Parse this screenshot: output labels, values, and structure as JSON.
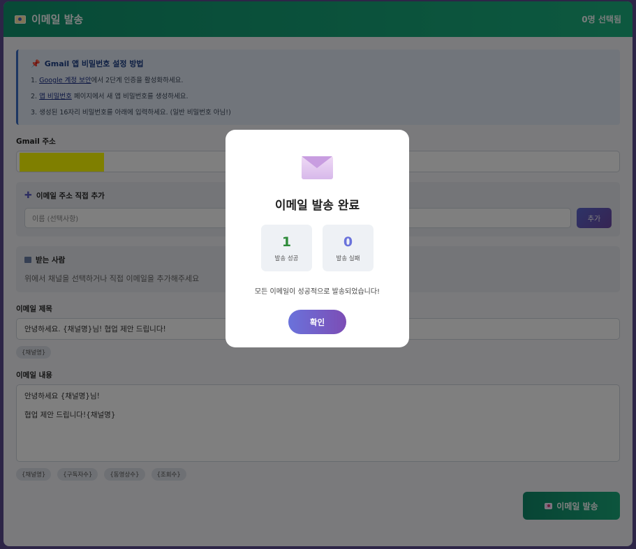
{
  "header": {
    "title": "이메일 발송",
    "selected_count": "0명 선택됨",
    "icon": "envelope-icon"
  },
  "guide": {
    "title": "Gmail 앱 비밀번호 설정 방법",
    "step1_prefix": "1. ",
    "step1_link": "Google 계정 보안",
    "step1_suffix": "에서 2단계 인증을 활성화하세요.",
    "step2_prefix": "2. ",
    "step2_link": "앱 비밀번호",
    "step2_suffix": " 페이지에서 새 앱 비밀번호를 생성하세요.",
    "step3": "3. 생성된 16자리 비밀번호를 아래에 입력하세요. (일반 비밀번호 아님!)"
  },
  "gmail": {
    "label": "Gmail 주소",
    "value": "te"
  },
  "add_email": {
    "title": "이메일 주소 직접 추가",
    "name_placeholder": "이름 (선택사항)",
    "add_label": "추가"
  },
  "recipients": {
    "title": "받는 사람",
    "hint": "위에서 채널을 선택하거나 직접 이메일을 추가해주세요"
  },
  "subject": {
    "label": "이메일 제목",
    "value": "안녕하세요. {채널명}님! 협업 제안 드립니다!",
    "chips": [
      "{채널명}"
    ]
  },
  "body": {
    "label": "이메일 내용",
    "value": "안녕하세요 {채널명}님!\n\n협업 제안 드립니다!{채널명}",
    "chips": [
      "{채널명}",
      "{구독자수}",
      "{동영상수}",
      "{조회수}"
    ]
  },
  "send_button": {
    "label": "이메일 발송"
  },
  "modal": {
    "title": "이메일 발송 완료",
    "success_count": "1",
    "success_label": "발송 성공",
    "fail_count": "0",
    "fail_label": "발송 실패",
    "message": "모든 이메일이 성공적으로 발송되었습니다!",
    "confirm_label": "확인"
  },
  "colors": {
    "header": "#10946e",
    "success": "#2e8b3a",
    "fail": "#6a72db",
    "accent": "#7c4db5"
  }
}
